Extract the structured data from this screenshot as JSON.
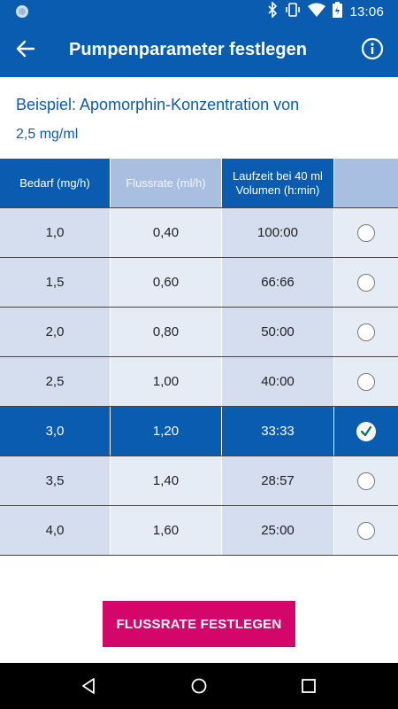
{
  "status_bar": {
    "time": "13:06"
  },
  "app_bar": {
    "title": "Pumpenparameter festlegen"
  },
  "subtitle": {
    "line1": "Beispiel: Apomorphin-Konzentration von",
    "line2": "2,5 mg/ml"
  },
  "table": {
    "headers": [
      "Bedarf (mg/h)",
      "Flussrate (ml/h)",
      "Laufzeit bei 40 ml\nVolumen (h:min)",
      ""
    ],
    "rows": [
      {
        "bedarf": "1,0",
        "flussrate": "0,40",
        "laufzeit": "100:00",
        "selected": false
      },
      {
        "bedarf": "1,5",
        "flussrate": "0,60",
        "laufzeit": "66:66",
        "selected": false
      },
      {
        "bedarf": "2,0",
        "flussrate": "0,80",
        "laufzeit": "50:00",
        "selected": false
      },
      {
        "bedarf": "2,5",
        "flussrate": "1,00",
        "laufzeit": "40:00",
        "selected": false
      },
      {
        "bedarf": "3,0",
        "flussrate": "1,20",
        "laufzeit": "33:33",
        "selected": true
      },
      {
        "bedarf": "3,5",
        "flussrate": "1,40",
        "laufzeit": "28:57",
        "selected": false
      },
      {
        "bedarf": "4,0",
        "flussrate": "1,60",
        "laufzeit": "25:00",
        "selected": false
      }
    ]
  },
  "action_button": {
    "label": "FLUSSRATE FESTLEGEN"
  },
  "colors": {
    "primary": "#0a5cb0",
    "accent": "#d4066a",
    "check": "#0a7a5a"
  },
  "icons": {
    "status_left": "app-notification-icon",
    "status_right": [
      "bluetooth-icon",
      "vibrate-icon",
      "wifi-icon",
      "battery-charging-icon"
    ],
    "app_bar": [
      "back-arrow-icon",
      "info-icon"
    ],
    "nav": [
      "nav-back-icon",
      "nav-home-icon",
      "nav-recents-icon"
    ]
  }
}
